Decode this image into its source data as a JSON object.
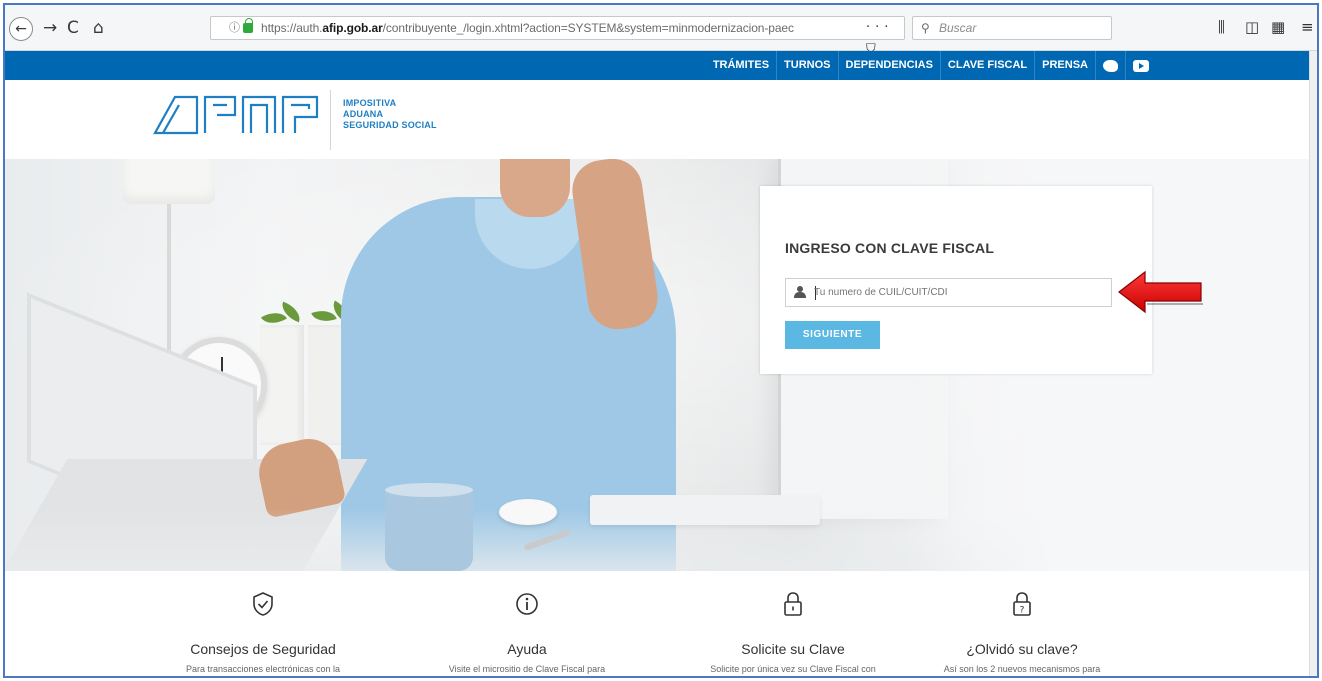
{
  "browser": {
    "url_prefix": "https://auth.",
    "url_domain": "afip.gob.ar",
    "url_path": "/contribuyente_/login.xhtml?action=SYSTEM&system=minmodernizacion-paec",
    "url_actions": "··· ⛉ ☆",
    "search_placeholder": "Buscar"
  },
  "topnav": {
    "items": [
      "TRÁMITES",
      "TURNOS",
      "DEPENDENCIAS",
      "CLAVE FISCAL",
      "PRENSA"
    ]
  },
  "logo": {
    "line1": "IMPOSITIVA",
    "line2": "ADUANA",
    "line3": "SEGURIDAD SOCIAL"
  },
  "login": {
    "title": "INGRESO CON CLAVE FISCAL",
    "input_placeholder": "Tu numero de CUIL/CUIT/CDI",
    "button_label": "SIGUIENTE"
  },
  "features": [
    {
      "title": "Consejos de Seguridad",
      "desc": "Para transacciones electrónicas con la",
      "icon": "shield-check-icon"
    },
    {
      "title": "Ayuda",
      "desc": "Visite el micrositio de Clave Fiscal para",
      "icon": "info-icon"
    },
    {
      "title": "Solicite su Clave",
      "desc": "Solicite por única vez su Clave Fiscal con",
      "icon": "lock-icon"
    },
    {
      "title": "¿Olvidó su clave?",
      "desc": "Así son los 2 nuevos mecanismos para",
      "icon": "lock-question-icon"
    }
  ],
  "colors": {
    "nav_blue": "#0067b2",
    "brand_blue": "#1e7fc4",
    "button_blue": "#5bb8e3",
    "annotation_red": "#e00000"
  }
}
